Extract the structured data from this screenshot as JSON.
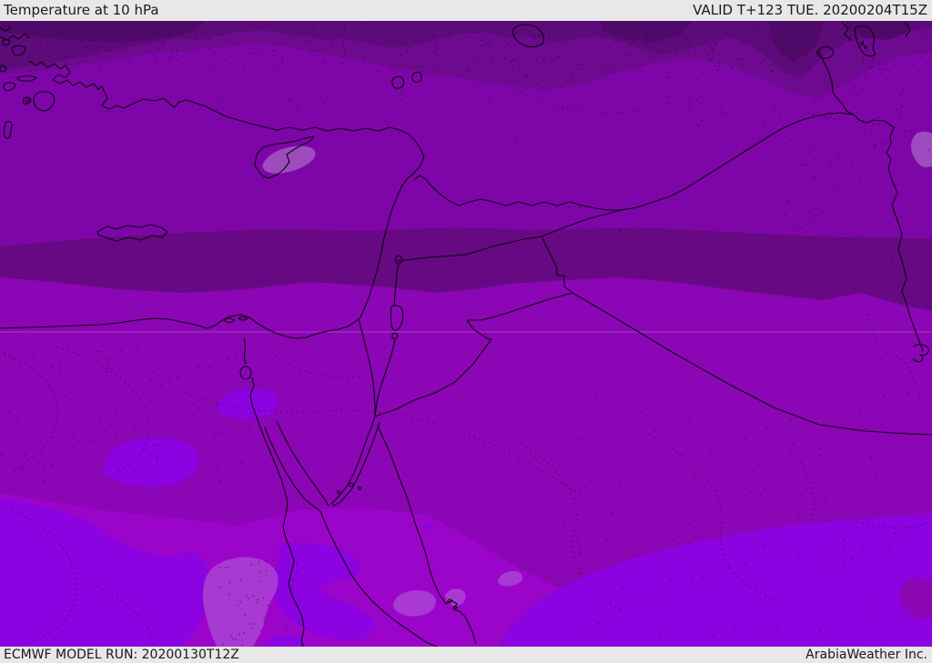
{
  "header": {
    "title": "Temperature at 10 hPa",
    "valid": "VALID T+123 TUE. 20200204T15Z",
    "bg": "#e8e8e8",
    "text_color": "#1a1a1a"
  },
  "footer": {
    "model_run": "ECMWF MODEL RUN: 20200130T12Z",
    "credit": "ArabiaWeather Inc.",
    "bg": "#e8e8e8",
    "text_color": "#1a1a1a"
  },
  "map": {
    "description": "ECMWF stratospheric temperature shading over the Eastern Mediterranean and Middle East; darker purple = colder bands to the north, brighter violet/magenta bands to the south",
    "colors": {
      "upper_bg": "#7E06A8",
      "band_l2": "#6D0A90",
      "band_l3": "#5D0A7A",
      "band_l4": "#4F0968",
      "mid_band": "#670982",
      "lower_band": "#8B06B4",
      "bottom_band": "#9B05C9",
      "violet": "#8A03E0",
      "lavender": "#9E4BBE",
      "lavender2": "#A839D2",
      "corner_blob": "#8B07B4",
      "graticule": "rgba(255,255,255,0.22)",
      "border_line": "#0b0410"
    }
  }
}
